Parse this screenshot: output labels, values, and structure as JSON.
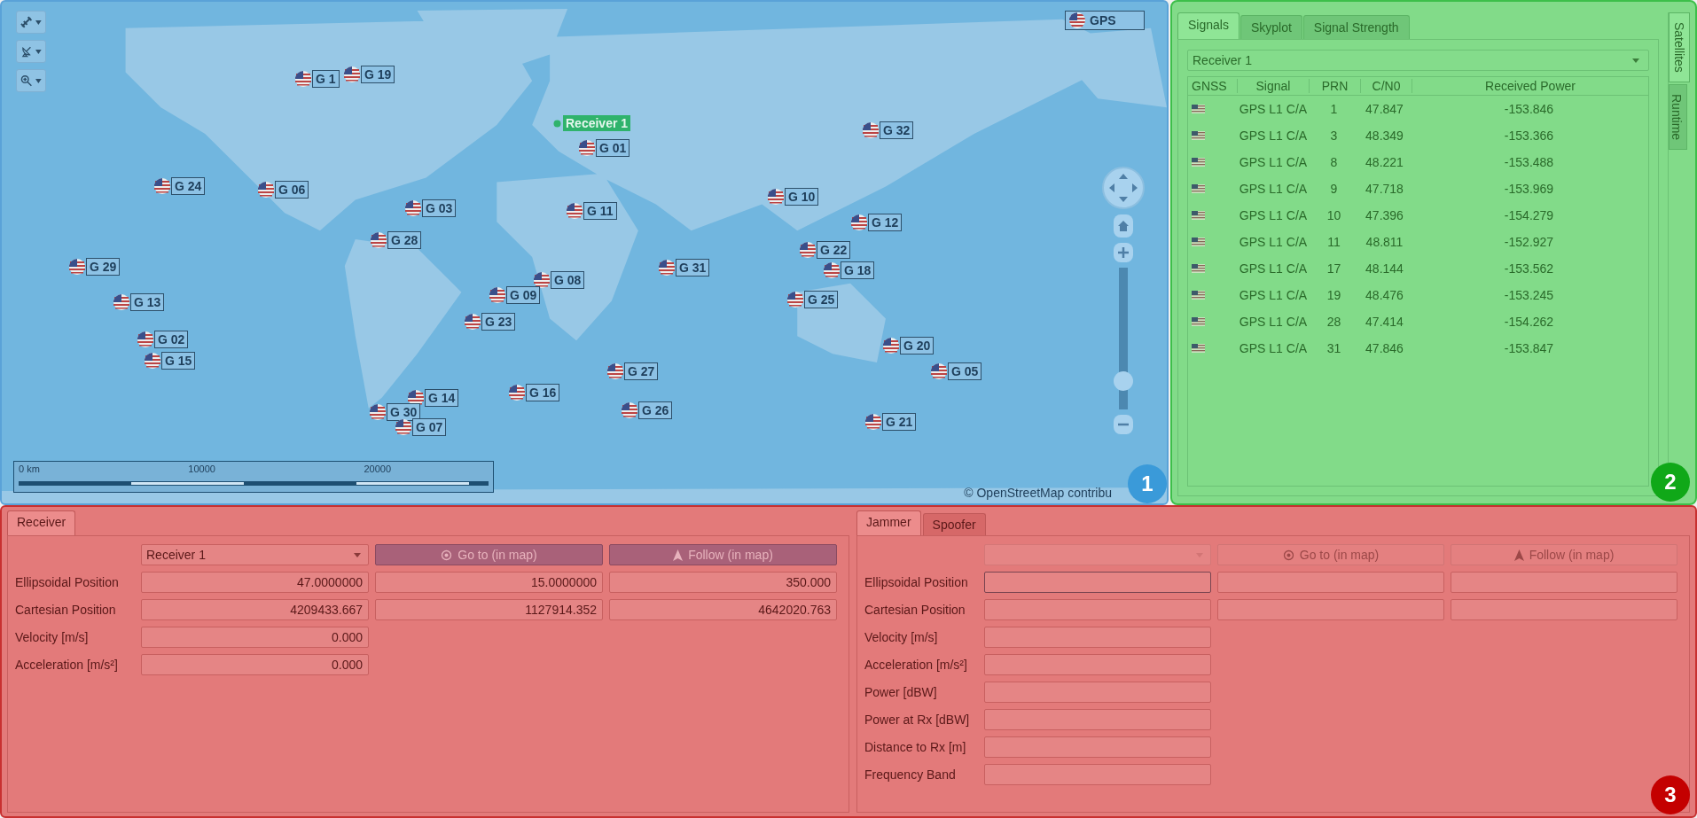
{
  "map": {
    "legend": {
      "label": "GPS"
    },
    "receiver": {
      "label": "Receiver 1"
    },
    "satellites": [
      {
        "label": "G 1"
      },
      {
        "label": "G 19"
      },
      {
        "label": "G 32"
      },
      {
        "label": "G 01"
      },
      {
        "label": "G 24"
      },
      {
        "label": "G 06"
      },
      {
        "label": "G 10"
      },
      {
        "label": "G 03"
      },
      {
        "label": "G 11"
      },
      {
        "label": "G 12"
      },
      {
        "label": "G 28"
      },
      {
        "label": "G 22"
      },
      {
        "label": "G 29"
      },
      {
        "label": "G 31"
      },
      {
        "label": "G 18"
      },
      {
        "label": "G 08"
      },
      {
        "label": "G 13"
      },
      {
        "label": "G 09"
      },
      {
        "label": "G 25"
      },
      {
        "label": "G 23"
      },
      {
        "label": "G 02"
      },
      {
        "label": "G 20"
      },
      {
        "label": "G 15"
      },
      {
        "label": "G 27"
      },
      {
        "label": "G 05"
      },
      {
        "label": "G 14"
      },
      {
        "label": "G 16"
      },
      {
        "label": "G 30"
      },
      {
        "label": "G 26"
      },
      {
        "label": "G 07"
      },
      {
        "label": "G 21"
      }
    ],
    "zoom_slider": {
      "level": 0.15
    },
    "scale_bar": {
      "labels": [
        "0 km",
        "10000",
        "20000"
      ]
    },
    "attribution": "© OpenStreetMap contribu",
    "badge": "1"
  },
  "satellites_panel": {
    "tabs": [
      {
        "label": "Signals",
        "selected": true
      },
      {
        "label": "Skyplot",
        "selected": false
      },
      {
        "label": "Signal Strength",
        "selected": false
      }
    ],
    "side_tabs": [
      {
        "label": "Satellites",
        "selected": true
      },
      {
        "label": "Runtime",
        "selected": false
      }
    ],
    "receiver_select": "Receiver 1",
    "table": {
      "columns": [
        "GNSS",
        "Signal",
        "PRN",
        "C/N0",
        "Received Power"
      ],
      "rows": [
        {
          "signal": "GPS L1 C/A",
          "prn": "1",
          "cn0": "47.847",
          "power": "-153.846"
        },
        {
          "signal": "GPS L1 C/A",
          "prn": "3",
          "cn0": "48.349",
          "power": "-153.366"
        },
        {
          "signal": "GPS L1 C/A",
          "prn": "8",
          "cn0": "48.221",
          "power": "-153.488"
        },
        {
          "signal": "GPS L1 C/A",
          "prn": "9",
          "cn0": "47.718",
          "power": "-153.969"
        },
        {
          "signal": "GPS L1 C/A",
          "prn": "10",
          "cn0": "47.396",
          "power": "-154.279"
        },
        {
          "signal": "GPS L1 C/A",
          "prn": "11",
          "cn0": "48.811",
          "power": "-152.927"
        },
        {
          "signal": "GPS L1 C/A",
          "prn": "17",
          "cn0": "48.144",
          "power": "-153.562"
        },
        {
          "signal": "GPS L1 C/A",
          "prn": "19",
          "cn0": "48.476",
          "power": "-153.245"
        },
        {
          "signal": "GPS L1 C/A",
          "prn": "28",
          "cn0": "47.414",
          "power": "-154.262"
        },
        {
          "signal": "GPS L1 C/A",
          "prn": "31",
          "cn0": "47.846",
          "power": "-153.847"
        }
      ]
    },
    "badge": "2"
  },
  "receiver_panel": {
    "tabs": [
      {
        "label": "Receiver",
        "selected": true
      }
    ],
    "select": {
      "value": "Receiver 1",
      "disabled": false
    },
    "buttons": [
      {
        "label": "Go to (in map)",
        "disabled": false
      },
      {
        "label": "Follow (in map)",
        "disabled": false
      }
    ],
    "rows": [
      {
        "label": "Ellipsoidal Position",
        "kind": "triple",
        "values": [
          "47.0000000",
          "15.0000000",
          "350.000"
        ]
      },
      {
        "label": "Cartesian Position",
        "kind": "triple",
        "values": [
          "4209433.667",
          "1127914.352",
          "4642020.763"
        ]
      },
      {
        "label": "Velocity [m/s]",
        "kind": "single",
        "values": [
          "0.000"
        ]
      },
      {
        "label": "Acceleration [m/s²]",
        "kind": "single",
        "values": [
          "0.000"
        ]
      }
    ]
  },
  "transmitter_panel": {
    "tabs": [
      {
        "label": "Jammer",
        "selected": true
      },
      {
        "label": "Spoofer",
        "selected": false
      }
    ],
    "select": {
      "disabled": true
    },
    "buttons": [
      {
        "label": "Go to (in map)",
        "disabled": true
      },
      {
        "label": "Follow (in map)",
        "disabled": true
      }
    ],
    "rows": [
      {
        "label": "Ellipsoidal Position",
        "kind": "triple"
      },
      {
        "label": "Cartesian Position",
        "kind": "triple"
      },
      {
        "label": "Velocity [m/s]",
        "kind": "single"
      },
      {
        "label": "Acceleration [m/s²]",
        "kind": "single"
      },
      {
        "label": "Power [dBW]",
        "kind": "single"
      },
      {
        "label": "Power at Rx [dBW]",
        "kind": "single"
      },
      {
        "label": "Distance to Rx [m]",
        "kind": "single"
      },
      {
        "label": "Frequency Band",
        "kind": "single"
      }
    ],
    "badge": "3"
  }
}
